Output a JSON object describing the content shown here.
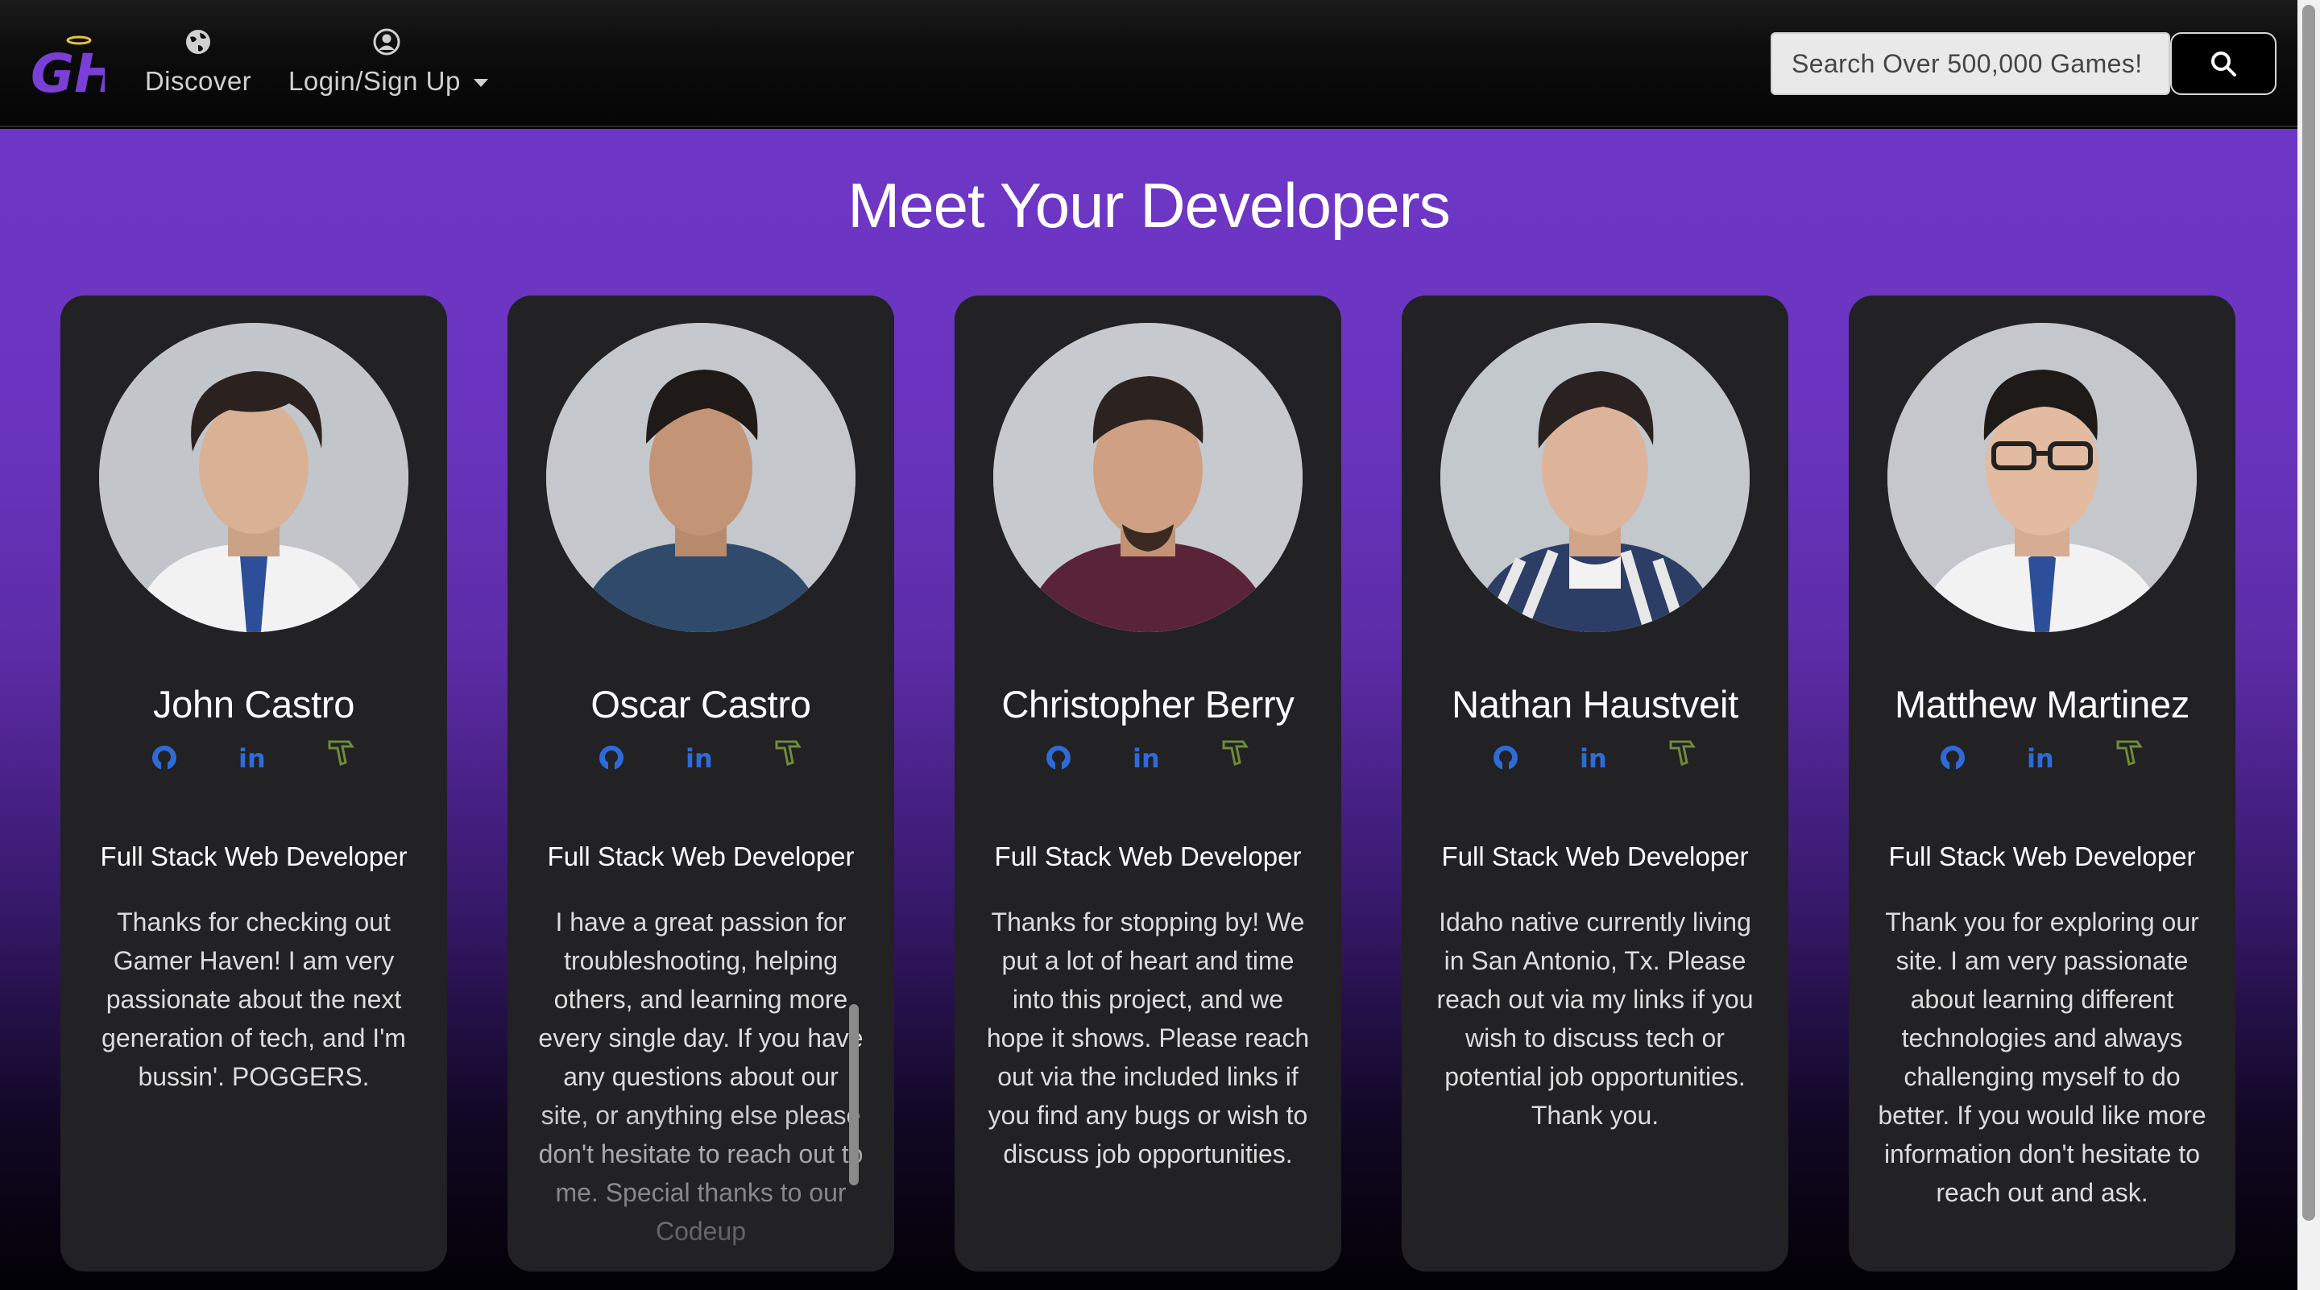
{
  "nav": {
    "logo_text": "GH",
    "discover_label": "Discover",
    "login_label": "Login/Sign Up",
    "search_placeholder": "Search Over 500,000 Games!"
  },
  "page": {
    "title": "Meet Your Developers"
  },
  "colors": {
    "accent_purple": "#6e36c6",
    "card_bg": "#222123",
    "github_blue": "#2f6bd8",
    "linkedin_blue": "#2f6bd8",
    "portfolio_green": "#6e8c3a"
  },
  "icons": [
    "globe-icon",
    "user-circle-icon",
    "caret-down-icon",
    "search-icon",
    "github-icon",
    "linkedin-icon",
    "portfolio-icon"
  ],
  "developers": [
    {
      "name": "John Castro",
      "role": "Full Stack Web Developer",
      "bio": "Thanks for checking out Gamer Haven! I am very passionate about the next generation of tech, and I'm bussin'. POGGERS."
    },
    {
      "name": "Oscar Castro",
      "role": "Full Stack Web Developer",
      "bio": "I have a great passion for troubleshooting, helping others, and learning more every single day. If you have any questions about our site, or anything else please don't hesitate to reach out to me. Special thanks to our Codeup"
    },
    {
      "name": "Christopher Berry",
      "role": "Full Stack Web Developer",
      "bio": "Thanks for stopping by! We put a lot of heart and time into this project, and we hope it shows. Please reach out via the included links if you find any bugs or wish to discuss job opportunities."
    },
    {
      "name": "Nathan Haustveit",
      "role": "Full Stack Web Developer",
      "bio": "Idaho native currently living in San Antonio, Tx. Please reach out via my links if you wish to discuss tech or potential job opportunities. Thank you."
    },
    {
      "name": "Matthew Martinez",
      "role": "Full Stack Web Developer",
      "bio": "Thank you for exploring our site. I am very passionate about learning different technologies and always challenging myself to do better. If you would like more information don't hesitate to reach out and ask."
    }
  ]
}
